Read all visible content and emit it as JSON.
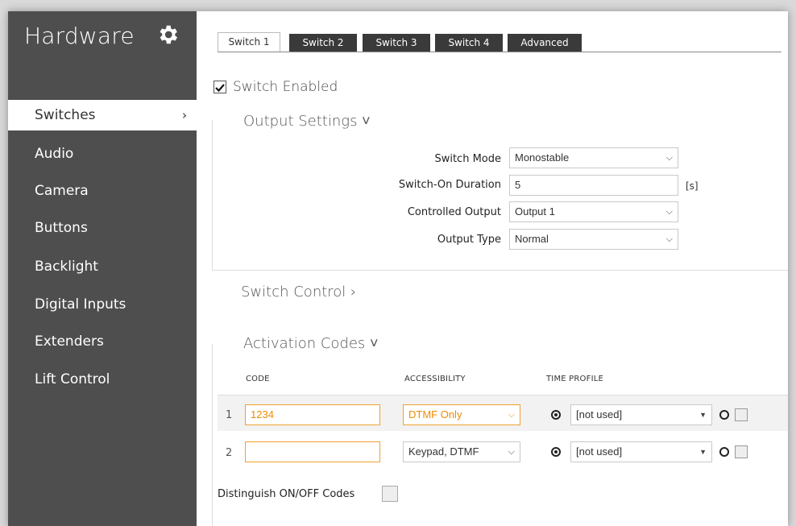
{
  "sidebar": {
    "title": "Hardware",
    "items": [
      {
        "label": "Switches",
        "active": true
      },
      {
        "label": "Audio"
      },
      {
        "label": "Camera"
      },
      {
        "label": "Buttons"
      },
      {
        "label": "Backlight"
      },
      {
        "label": "Digital Inputs"
      },
      {
        "label": "Extenders"
      },
      {
        "label": "Lift Control"
      }
    ],
    "chevron": "›"
  },
  "tabs": [
    "Switch 1",
    "Switch 2",
    "Switch 3",
    "Switch 4",
    "Advanced"
  ],
  "switch_enabled": {
    "label": "Switch Enabled",
    "checked": true
  },
  "output_settings": {
    "title": "Output Settings ˅",
    "switch_mode": {
      "label": "Switch Mode",
      "value": "Monostable"
    },
    "switch_on_duration": {
      "label": "Switch-On Duration",
      "value": "5",
      "unit": "[s]"
    },
    "controlled_output": {
      "label": "Controlled Output",
      "value": "Output 1"
    },
    "output_type": {
      "label": "Output Type",
      "value": "Normal"
    }
  },
  "switch_control": {
    "title": "Switch Control ›"
  },
  "activation_codes": {
    "title": "Activation Codes ˅",
    "headers": {
      "code": "CODE",
      "accessibility": "ACCESSIBILITY",
      "time_profile": "TIME PROFILE"
    },
    "rows": [
      {
        "num": "1",
        "code": "1234",
        "accessibility": "DTMF Only",
        "time_profile": "[not used]"
      },
      {
        "num": "2",
        "code": "",
        "accessibility": "Keypad, DTMF",
        "time_profile": "[not used]"
      }
    ],
    "distinguish_label": "Distinguish ON/OFF Codes"
  },
  "colors": {
    "sidebar": "#4e4e4e",
    "accent": "#f08a00",
    "tab_dark": "#3a3a3a"
  }
}
